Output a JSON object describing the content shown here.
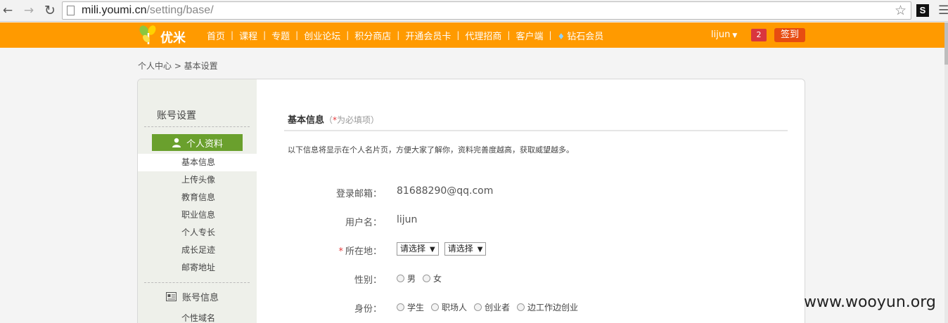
{
  "browser": {
    "url_host": "mili.youmi.cn",
    "url_path": "/setting/base/",
    "extension_label": "S",
    "icons": [
      "back-arrow-icon",
      "forward-arrow-icon",
      "reload-icon",
      "page-icon",
      "star-icon",
      "menu-icon"
    ]
  },
  "header": {
    "brand": "优米",
    "nav": [
      "首页",
      "课程",
      "专题",
      "创业论坛",
      "积分商店",
      "开通会员卡",
      "代理招商",
      "客户端",
      "钻石会员"
    ],
    "username": "lijun",
    "notification_count": "2",
    "signin_label": "签到",
    "accent_color": "#ff9a00"
  },
  "breadcrumb": "个人中心 > 基本设置",
  "sidebar": {
    "title": "账号设置",
    "active_group": "个人资料",
    "links": [
      "基本信息",
      "上传头像",
      "教育信息",
      "职业信息",
      "个人专长",
      "成长足迹",
      "邮寄地址"
    ],
    "current_link": "基本信息",
    "group2": "账号信息",
    "group2_links": [
      "个性域名"
    ]
  },
  "main": {
    "section_title": "基本信息",
    "section_note_open": "（",
    "section_note_star": "*",
    "section_note_text": "为必填项",
    "section_note_close": "）",
    "intro": "以下信息将显示在个人名片页，方便大家了解你，资料完善度越高，获取威望越多。",
    "fields": {
      "email_label": "登录邮箱：",
      "email_value": "81688290@qq.com",
      "username_label": "用户名：",
      "username_value": "lijun",
      "location_label": "所在地：",
      "location_required": "*",
      "province_select": "请选择",
      "city_select": "请选择",
      "gender_label": "性别：",
      "gender_options": [
        "男",
        "女"
      ],
      "identity_label": "身份：",
      "identity_options": [
        "学生",
        "职场人",
        "创业者",
        "边工作边创业"
      ]
    }
  },
  "watermark": "www.wooyun.org"
}
